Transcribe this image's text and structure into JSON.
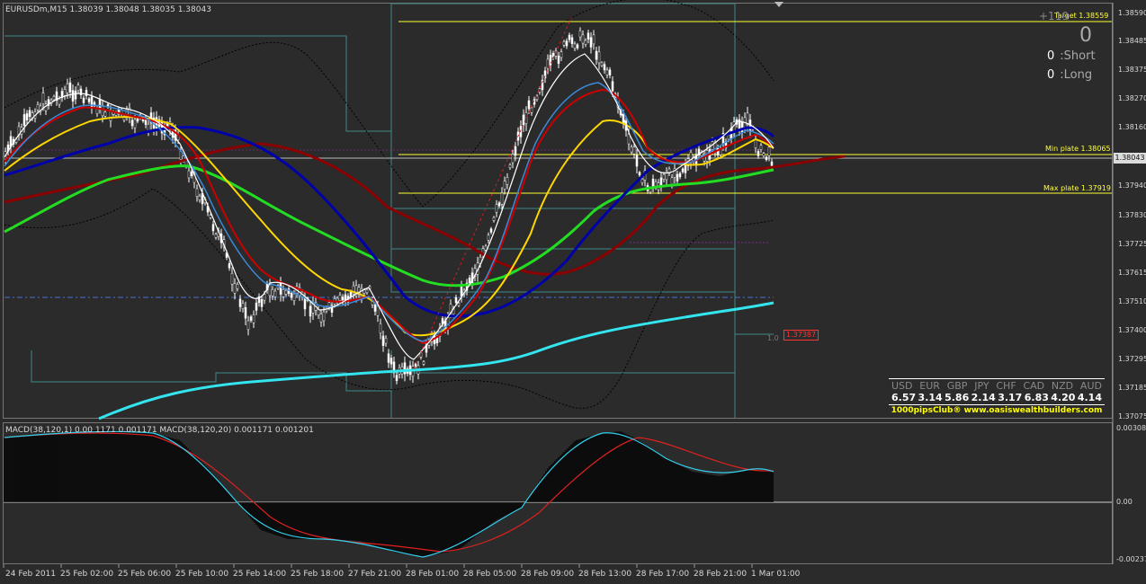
{
  "chart": {
    "header": "EURUSDm,M15  1.38039 1.38048 1.38035 1.38043",
    "macd_header": "MACD(38,120,1) 0.00 1171 0.001171   MACD(38,120,20) 0.001171 0.001201"
  },
  "price_axis": {
    "labels": [
      "1.38590",
      "1.38485",
      "1.38375",
      "1.38270",
      "1.38160",
      "1.37940",
      "1.37830",
      "1.37725",
      "1.37615",
      "1.37510",
      "1.37400",
      "1.37295",
      "1.37185",
      "1.37075"
    ],
    "current_price": "1.38043"
  },
  "macd_axis": {
    "labels": [
      "0.00308",
      "0.00",
      "-0.00237"
    ]
  },
  "time_axis": {
    "labels": [
      "24 Feb 2011",
      "25 Feb 02:00",
      "25 Feb 06:00",
      "25 Feb 10:00",
      "25 Feb 14:00",
      "25 Feb 18:00",
      "27 Feb 21:00",
      "28 Feb 01:00",
      "28 Feb 05:00",
      "28 Feb 09:00",
      "28 Feb 13:00",
      "28 Feb 17:00",
      "28 Feb 21:00",
      "1 Mar 01:00"
    ]
  },
  "levels": {
    "target": "Target 1.38559",
    "min_plate": "Min plate 1.38065",
    "max_plate": "Max plate 1.37919",
    "low_badge": "1.37387",
    "level_tag": "1.0"
  },
  "panel": {
    "profit": "+119",
    "total": "0",
    "short_count": "0",
    "short_label": ":Short",
    "long_count": "0",
    "long_label": ":Long"
  },
  "currency_strength": {
    "headers": [
      "USD",
      "EUR",
      "GBP",
      "JPY",
      "CHF",
      "CAD",
      "NZD",
      "AUD"
    ],
    "values": [
      "6.57",
      "3.14",
      "5.86",
      "2.14",
      "3.17",
      "6.83",
      "4.20",
      "4.14"
    ],
    "footer": "1000pipsClub® www.oasiswealthbuilders.com"
  },
  "colors": {
    "background": "#2b2b2b",
    "ma_red": "#cc0000",
    "ma_dark_red": "#8b0000",
    "ma_navy": "#0000aa",
    "ma_green": "#22dd22",
    "ma_yellow": "#ffd700",
    "ma_cyan": "#33e5ee",
    "level_yellow": "#ffff33"
  }
}
